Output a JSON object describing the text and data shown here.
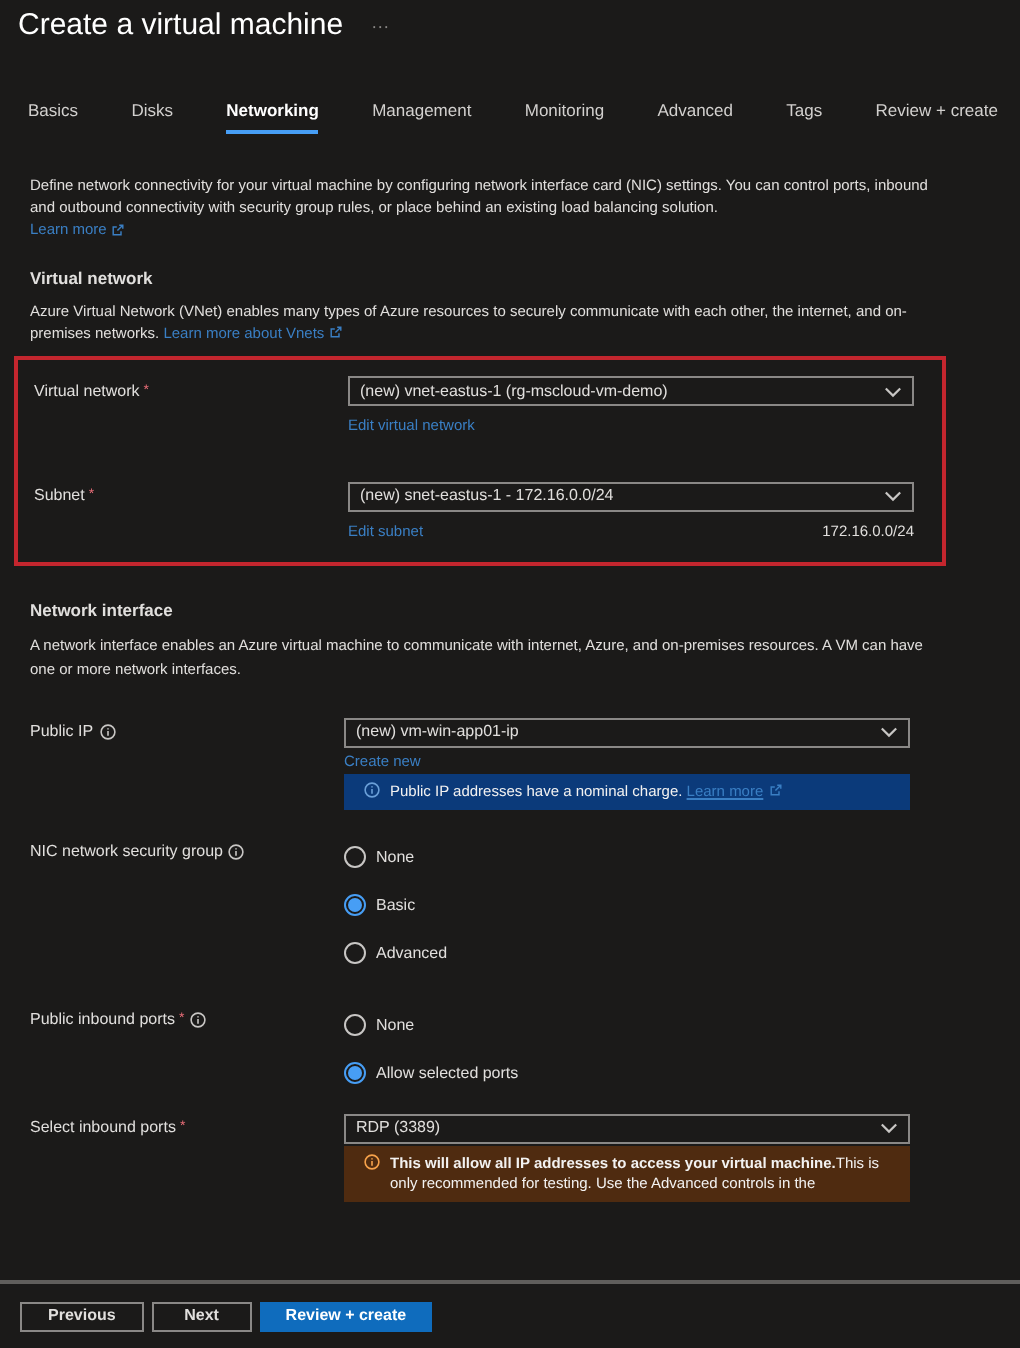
{
  "page": {
    "title": "Create a virtual machine",
    "more": "···"
  },
  "tabs": [
    {
      "label": "Basics",
      "selected": false
    },
    {
      "label": "Disks",
      "selected": false
    },
    {
      "label": "Networking",
      "selected": true
    },
    {
      "label": "Management",
      "selected": false
    },
    {
      "label": "Monitoring",
      "selected": false
    },
    {
      "label": "Advanced",
      "selected": false
    },
    {
      "label": "Tags",
      "selected": false
    },
    {
      "label": "Review + create",
      "selected": false
    }
  ],
  "intro": {
    "text": "Define network connectivity for your virtual machine by configuring network interface card (NIC) settings. You can control ports, inbound and outbound connectivity with security group rules, or place behind an existing load balancing solution.",
    "link": "Learn more"
  },
  "virtual_network": {
    "heading": "Virtual network",
    "description": "Azure Virtual Network (VNet) enables many types of Azure resources to securely communicate with each other, the internet, and on-premises networks.",
    "link": "Learn more about Vnets",
    "highlighted": true,
    "fields": [
      {
        "label": "Virtual network",
        "required_mark": "*",
        "value": "(new) vnet-eastus-1 (rg-mscloud-vm-demo)",
        "link": "Edit virtual network"
      },
      {
        "label": "Subnet",
        "required_mark": "*",
        "value": "(new) snet-eastus-1 - 172.16.0.0/24",
        "link": "Edit subnet",
        "note": "172.16.0.0/24"
      }
    ]
  },
  "network_interface": {
    "heading": "Network interface",
    "description": "A network interface enables an Azure virtual machine to communicate with internet, Azure, and on-premises resources. A VM can have one or more network interfaces.",
    "fields": [
      {
        "kind": "select",
        "label": "Public IP",
        "info": true,
        "value": "(new) vm-win-app01-ip",
        "link": "Create new",
        "banner": {
          "kind": "info",
          "text": "Public IP addresses have a nominal charge.",
          "link": "Learn more"
        }
      },
      {
        "kind": "radio",
        "label": "NIC network security group",
        "info": true,
        "options": [
          {
            "label": "None",
            "selected": false
          },
          {
            "label": "Basic",
            "selected": true
          },
          {
            "label": "Advanced",
            "selected": false
          }
        ]
      },
      {
        "kind": "radio",
        "label": "Public inbound ports",
        "required_mark": "*",
        "info": true,
        "options": [
          {
            "label": "None",
            "selected": false
          },
          {
            "label": "Allow selected ports",
            "selected": true
          }
        ]
      },
      {
        "kind": "select",
        "label": "Select inbound ports",
        "required_mark": "*",
        "value": "RDP (3389)",
        "banner": {
          "kind": "warning",
          "text": "**This will allow all IP addresses to access your virtual machine.**This is only recommended for testing. Use the Advanced controls in the"
        }
      }
    ]
  },
  "footer": {
    "buttons": [
      {
        "label": "Previous",
        "kind": "secondary"
      },
      {
        "label": "Next",
        "kind": "secondary"
      },
      {
        "label": "Review + create",
        "kind": "primary"
      }
    ]
  }
}
